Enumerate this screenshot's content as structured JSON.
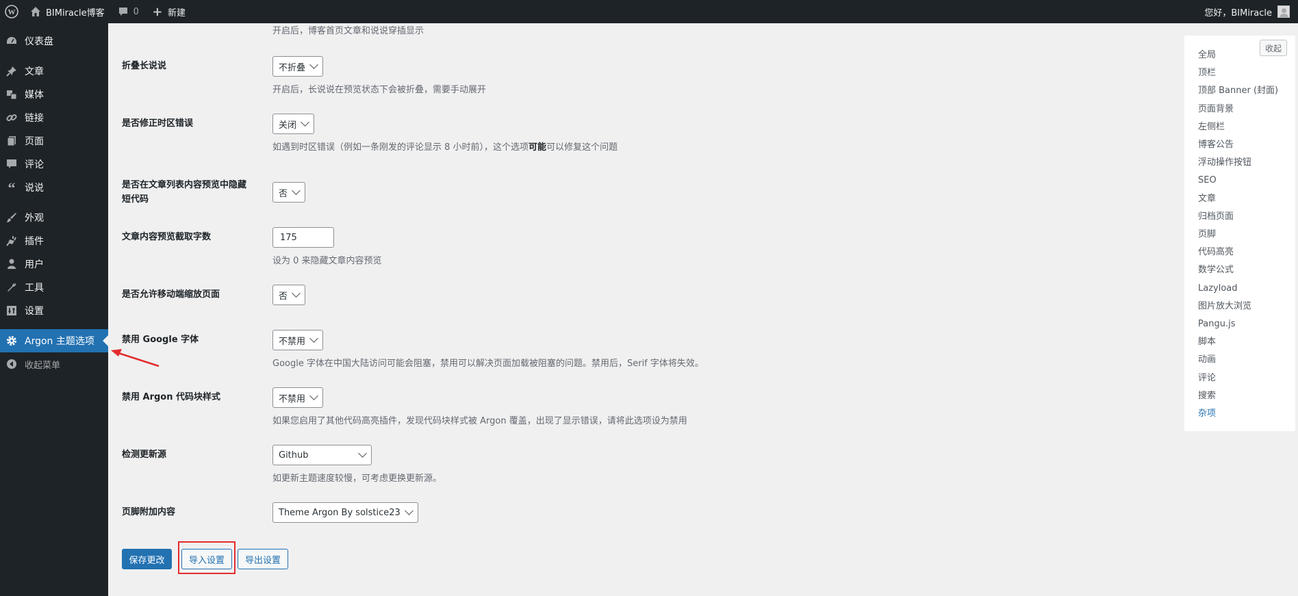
{
  "adminbar": {
    "site_name": "BIMiracle博客",
    "comment_count": "0",
    "new_label": "新建",
    "greeting": "您好，BIMiracle"
  },
  "sidebar": {
    "items": [
      {
        "label": "仪表盘",
        "icon": "dashboard-icon"
      },
      {
        "label": "文章",
        "icon": "pin-icon"
      },
      {
        "label": "媒体",
        "icon": "media-icon"
      },
      {
        "label": "链接",
        "icon": "link-icon"
      },
      {
        "label": "页面",
        "icon": "page-icon"
      },
      {
        "label": "评论",
        "icon": "comment-icon"
      },
      {
        "label": "说说",
        "icon": "quote-icon"
      },
      {
        "label": "外观",
        "icon": "brush-icon"
      },
      {
        "label": "插件",
        "icon": "plugin-icon"
      },
      {
        "label": "用户",
        "icon": "user-icon"
      },
      {
        "label": "工具",
        "icon": "wrench-icon"
      },
      {
        "label": "设置",
        "icon": "settings-icon"
      },
      {
        "label": "Argon 主题选项",
        "icon": "gear-icon"
      },
      {
        "label": "收起菜单",
        "icon": "collapse-icon"
      }
    ]
  },
  "settings": {
    "top_desc": "开启后，博客首页文章和说说穿插显示",
    "fold": {
      "label": "折叠长说说",
      "value": "不折叠",
      "desc": "开启后，长说说在预览状态下会被折叠，需要手动展开"
    },
    "timezone": {
      "label": "是否修正时区错误",
      "value": "关闭",
      "desc_before": "如遇到时区错误（例如一条刚发的评论显示 8 小时前），这个选项",
      "desc_bold": "可能",
      "desc_after": "可以修复这个问题"
    },
    "hide_shortcode": {
      "label_line1": "是否在文章列表内容预览中隐藏",
      "label_line2": "短代码",
      "value": "否"
    },
    "excerpt": {
      "label": "文章内容预览截取字数",
      "value": "175",
      "desc": "设为 0 来隐藏文章内容预览"
    },
    "mobile_zoom": {
      "label": "是否允许移动端缩放页面",
      "value": "否"
    },
    "google_font": {
      "label": "禁用 Google 字体",
      "value": "不禁用",
      "desc": "Google 字体在中国大陆访问可能会阻塞，禁用可以解决页面加载被阻塞的问题。禁用后，Serif 字体将失效。"
    },
    "code_style": {
      "label": "禁用 Argon 代码块样式",
      "value": "不禁用",
      "desc": "如果您启用了其他代码高亮插件，发现代码块样式被 Argon 覆盖，出现了显示错误，请将此选项设为禁用"
    },
    "update_source": {
      "label": "检测更新源",
      "value": "Github",
      "desc": "如更新主题速度较慢，可考虑更换更新源。"
    },
    "footer": {
      "label": "页脚附加内容",
      "value": "Theme Argon By solstice23"
    }
  },
  "buttons": {
    "save": "保存更改",
    "import": "导入设置",
    "export": "导出设置"
  },
  "toc": {
    "collapse": "收起",
    "items": [
      "全局",
      "顶栏",
      "顶部 Banner (封面)",
      "页面背景",
      "左侧栏",
      "博客公告",
      "浮动操作按钮",
      "SEO",
      "文章",
      "归档页面",
      "页脚",
      "代码高亮",
      "数学公式",
      "Lazyload",
      "图片放大浏览",
      "Pangu.js",
      "脚本",
      "动画",
      "评论",
      "搜索",
      "杂项"
    ],
    "active_index": 20
  },
  "colors": {
    "accent": "#2271b1",
    "highlight": "#e32c2c",
    "dark": "#1d2327"
  }
}
